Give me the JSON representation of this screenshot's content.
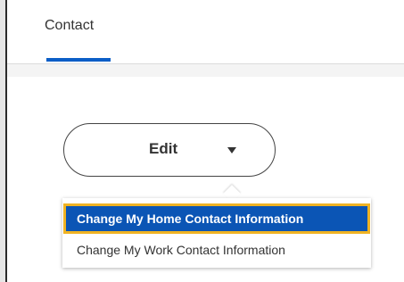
{
  "tabs": [
    {
      "label": "Contact",
      "active": true
    }
  ],
  "edit_button": {
    "label": "Edit",
    "icon": "caret-down-icon"
  },
  "dropdown": {
    "items": [
      {
        "label": "Change My Home Contact Information",
        "highlighted": true
      },
      {
        "label": "Change My Work Contact Information",
        "highlighted": false
      }
    ]
  },
  "colors": {
    "accent": "#0b5ec7",
    "highlight_bg": "#0b55b5",
    "highlight_outline": "#f0b323"
  }
}
